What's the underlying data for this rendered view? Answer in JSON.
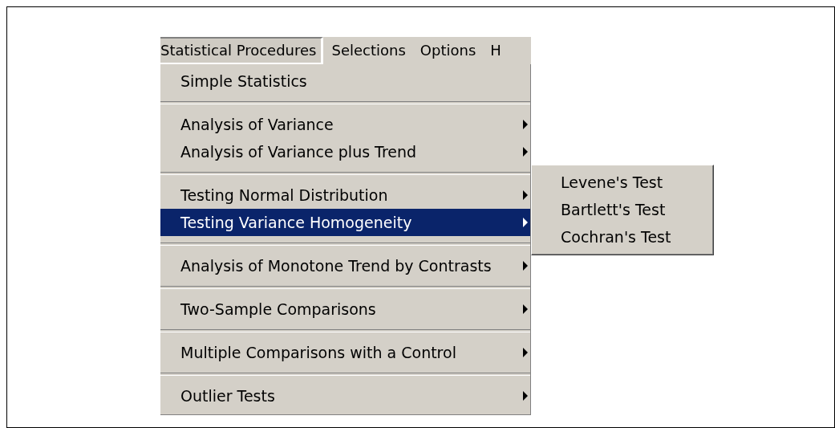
{
  "menu_bar": [
    {
      "label": "Statistical Procedures",
      "selected": true
    },
    {
      "label": "Selections",
      "selected": false
    },
    {
      "label": "Options",
      "selected": false
    },
    {
      "label": "H",
      "selected": false
    }
  ],
  "menu": {
    "groups": [
      {
        "items": [
          {
            "label": "Simple Statistics",
            "has_submenu": false,
            "selected": false
          }
        ]
      },
      {
        "items": [
          {
            "label": "Analysis of Variance",
            "has_submenu": true,
            "selected": false
          },
          {
            "label": "Analysis of Variance plus Trend",
            "has_submenu": true,
            "selected": false
          }
        ]
      },
      {
        "items": [
          {
            "label": "Testing Normal Distribution",
            "has_submenu": true,
            "selected": false
          },
          {
            "label": "Testing Variance Homogeneity",
            "has_submenu": true,
            "selected": true
          }
        ]
      },
      {
        "items": [
          {
            "label": "Analysis of Monotone Trend by Contrasts",
            "has_submenu": true,
            "selected": false
          }
        ]
      },
      {
        "items": [
          {
            "label": "Two-Sample Comparisons",
            "has_submenu": true,
            "selected": false
          }
        ]
      },
      {
        "items": [
          {
            "label": "Multiple Comparisons with a Control",
            "has_submenu": true,
            "selected": false
          }
        ]
      },
      {
        "items": [
          {
            "label": "Outlier Tests",
            "has_submenu": true,
            "selected": false
          }
        ]
      }
    ]
  },
  "submenu": {
    "items": [
      {
        "label": "Levene's Test"
      },
      {
        "label": "Bartlett's Test"
      },
      {
        "label": "Cochran's Test"
      }
    ]
  }
}
